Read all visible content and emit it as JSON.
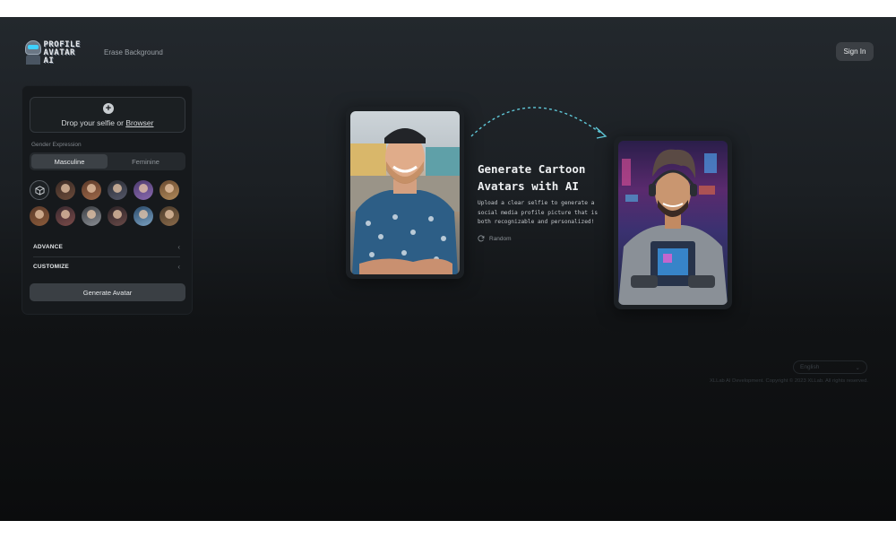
{
  "header": {
    "logo_text_line1": "PROFILE",
    "logo_text_line2": "AVATAR AI",
    "nav_link": "Erase Background",
    "signin_label": "Sign In"
  },
  "panel": {
    "drop_text": "Drop your selfie or",
    "drop_link": "Browser",
    "gender_label": "Gender Expression",
    "gender_options": [
      "Masculine",
      "Feminine"
    ],
    "gender_selected": "Masculine",
    "avatar_icons": [
      "cube-icon"
    ],
    "sections": [
      "ADVANCE",
      "CUSTOMIZE"
    ],
    "generate_label": "Generate Avatar"
  },
  "hero": {
    "headline": "Generate Cartoon Avatars with AI",
    "description": "Upload a clear selfie to generate a social media profile picture that is both recognizable and personalized!",
    "random_label": "Random"
  },
  "footer": {
    "language": "English",
    "copyright": "XLLab AI Development. Copyright © 2023 XLLab. All rights reserved."
  },
  "colors": {
    "background_top": "#23282d",
    "background_bottom": "#0b0c0d",
    "panel_bg": "#16191c",
    "button_bg": "#3a3f44",
    "arc_dash": "#5fc8d8"
  }
}
